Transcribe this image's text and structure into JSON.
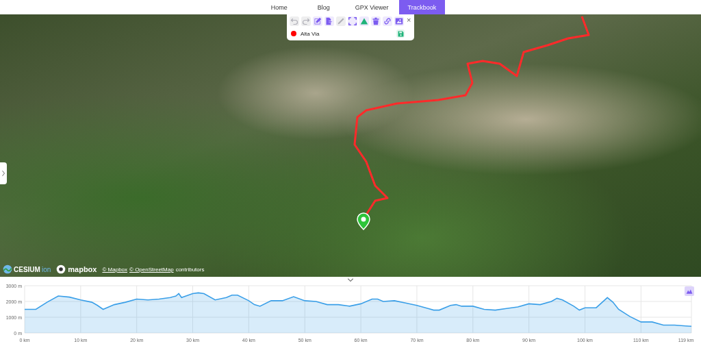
{
  "nav": [
    {
      "label": "Home",
      "selected": false
    },
    {
      "label": "Blog",
      "selected": false
    },
    {
      "label": "GPX Viewer",
      "selected": false
    },
    {
      "label": "Trackbook",
      "selected": true
    }
  ],
  "toolbar": {
    "tools": [
      {
        "kind": "undo",
        "disabled": true
      },
      {
        "kind": "redo",
        "disabled": true
      },
      {
        "kind": "edit",
        "disabled": false
      },
      {
        "kind": "export",
        "disabled": false
      },
      {
        "kind": "ruler",
        "disabled": true
      },
      {
        "kind": "fullscreen",
        "disabled": false
      },
      {
        "kind": "mountain",
        "disabled": false
      },
      {
        "kind": "trash",
        "disabled": false
      },
      {
        "kind": "link",
        "disabled": false
      },
      {
        "kind": "image",
        "disabled": false
      }
    ],
    "close": "×",
    "tracks": [
      {
        "name": "Alta Via",
        "color": "#ff0000"
      }
    ]
  },
  "map": {
    "logos": [
      "CESIUM",
      "ion",
      "mapbox"
    ],
    "attribution": [
      "© Mapbox",
      "© OpenStreetMap",
      "contributors"
    ]
  },
  "profile": {
    "chart_data": {
      "type": "area",
      "x": [
        0,
        2,
        4,
        6,
        8,
        10,
        12,
        13,
        14,
        16,
        18,
        20,
        22,
        24,
        26,
        27,
        27.5,
        28,
        30,
        31,
        32,
        34,
        36,
        37,
        38,
        40,
        41,
        42,
        44,
        46,
        48,
        50,
        52,
        54,
        56,
        58,
        60,
        62,
        63,
        64,
        66,
        68,
        70,
        72,
        73,
        74,
        76,
        77,
        78,
        80,
        82,
        84,
        86,
        88,
        90,
        92,
        94,
        95,
        96,
        98,
        99,
        100,
        102,
        104,
        105,
        106,
        108,
        110,
        112,
        114,
        116,
        118,
        119
      ],
      "grid": true,
      "series": [
        {
          "color": "#3a9fe8",
          "values": [
            1500,
            1500,
            1950,
            2350,
            2280,
            2100,
            1950,
            1750,
            1500,
            1800,
            1950,
            2150,
            2100,
            2150,
            2250,
            2350,
            2500,
            2250,
            2500,
            2550,
            2500,
            2100,
            2250,
            2400,
            2400,
            2050,
            1800,
            1700,
            2050,
            2050,
            2300,
            2050,
            2000,
            1800,
            1800,
            1700,
            1850,
            2150,
            2150,
            2000,
            2050,
            1900,
            1750,
            1550,
            1450,
            1450,
            1750,
            1800,
            1700,
            1700,
            1500,
            1450,
            1550,
            1650,
            1850,
            1800,
            2000,
            2200,
            2100,
            1700,
            1450,
            1600,
            1600,
            2250,
            1950,
            1500,
            1050,
            700,
            700,
            500,
            500,
            450,
            420
          ]
        }
      ],
      "xlim": [
        0,
        119
      ],
      "ylim": [
        0,
        3000
      ],
      "xticks": [
        {
          "value": 0,
          "label": "0 km"
        },
        {
          "value": 10,
          "label": "10 km"
        },
        {
          "value": 20,
          "label": "20 km"
        },
        {
          "value": 30,
          "label": "30 km"
        },
        {
          "value": 40,
          "label": "40 km"
        },
        {
          "value": 50,
          "label": "50 km"
        },
        {
          "value": 60,
          "label": "60 km"
        },
        {
          "value": 70,
          "label": "70 km"
        },
        {
          "value": 80,
          "label": "80 km"
        },
        {
          "value": 90,
          "label": "90 km"
        },
        {
          "value": 100,
          "label": "100 km"
        },
        {
          "value": 110,
          "label": "110 km"
        },
        {
          "value": 119,
          "label": "119 km"
        }
      ],
      "yticks": [
        {
          "value": 0,
          "label": "0 m"
        },
        {
          "value": 1000,
          "label": "1000 m"
        },
        {
          "value": 2000,
          "label": "2000 m"
        },
        {
          "value": 3000,
          "label": "3000 m"
        }
      ]
    }
  }
}
